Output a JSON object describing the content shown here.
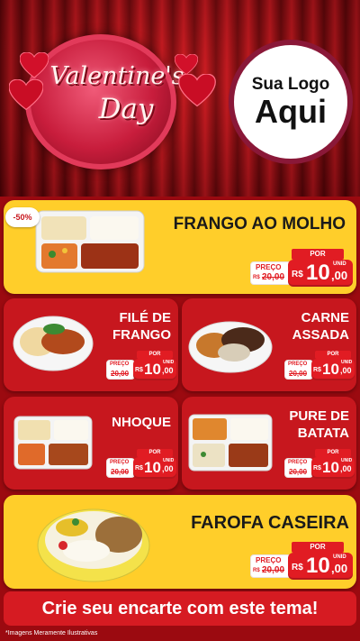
{
  "header": {
    "title_line1": "Valentine's",
    "title_line2": "Day",
    "logo_line1": "Sua Logo",
    "logo_line2": "Aqui"
  },
  "discount_badge": "-50%",
  "products": [
    {
      "name_line1": "FRANGO AO MOLHO",
      "name_line2": "",
      "por": "POR",
      "preco": "PREÇO",
      "old_prefix": "R$",
      "old_price": "20,00",
      "currency": "R$",
      "price_int": "10",
      "price_dec": ",00",
      "unit": "UNID"
    },
    {
      "name_line1": "FILÉ DE",
      "name_line2": "FRANGO",
      "por": "POR",
      "preco": "PREÇO",
      "old_prefix": "R$",
      "old_price": "20,00",
      "currency": "R$",
      "price_int": "10",
      "price_dec": ",00",
      "unit": "UNID"
    },
    {
      "name_line1": "CARNE",
      "name_line2": "ASSADA",
      "por": "POR",
      "preco": "PREÇO",
      "old_prefix": "R$",
      "old_price": "20,00",
      "currency": "R$",
      "price_int": "10",
      "price_dec": ",00",
      "unit": "UNID"
    },
    {
      "name_line1": "NHOQUE",
      "name_line2": "",
      "por": "POR",
      "preco": "PREÇO",
      "old_prefix": "R$",
      "old_price": "20,00",
      "currency": "R$",
      "price_int": "10",
      "price_dec": ",00",
      "unit": "UNID"
    },
    {
      "name_line1": "PURE DE",
      "name_line2": "BATATA",
      "por": "POR",
      "preco": "PREÇO",
      "old_prefix": "R$",
      "old_price": "20,00",
      "currency": "R$",
      "price_int": "10",
      "price_dec": ",00",
      "unit": "UNID"
    },
    {
      "name_line1": "FAROFA CASEIRA",
      "name_line2": "",
      "por": "POR",
      "preco": "PREÇO",
      "old_prefix": "R$",
      "old_price": "20,00",
      "currency": "R$",
      "price_int": "10",
      "price_dec": ",00",
      "unit": "UNID"
    }
  ],
  "cta": "Crie seu encarte com este tema!",
  "footnote": "*Imagens Meramente Ilustrativas",
  "colors": {
    "background": "#9b0a10",
    "card_yellow": "#ffce2a",
    "card_red": "#c7171e",
    "price_red": "#e11c23"
  },
  "icons": [
    "heart-icon",
    "food-tray-icon",
    "food-bowl-icon"
  ]
}
